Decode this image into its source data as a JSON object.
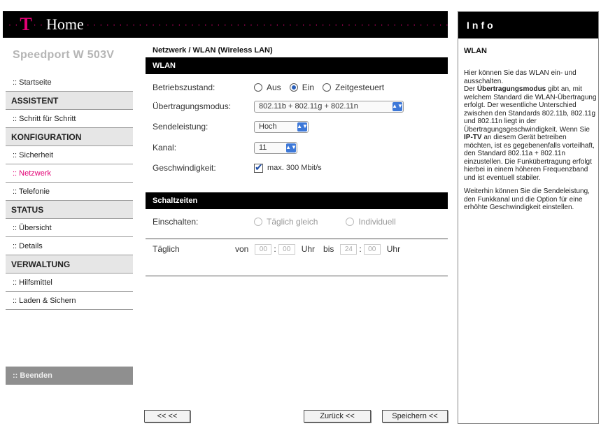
{
  "header": {
    "dots_left": "· ·",
    "logo": "T",
    "dots_mid": "· ·",
    "title": "Home",
    "dots_right": "· · · · · · · · · · · · · · · · · · · · · · · · · · · · · · · · · · · · · · · · · · · · · · · · · · · · · · · · · · · · · · · · · · · · · · · · · · · · · · · · · · · · · · · ·"
  },
  "sidebar": {
    "device_name": "Speedport W 503V",
    "items": [
      {
        "label": ":: Startseite",
        "type": "item"
      },
      {
        "label": "ASSISTENT",
        "type": "section"
      },
      {
        "label": ":: Schritt für Schritt",
        "type": "item"
      },
      {
        "label": "KONFIGURATION",
        "type": "section"
      },
      {
        "label": ":: Sicherheit",
        "type": "item"
      },
      {
        "label": ":: Netzwerk",
        "type": "item",
        "active": true
      },
      {
        "label": ":: Telefonie",
        "type": "item"
      },
      {
        "label": "STATUS",
        "type": "section"
      },
      {
        "label": ":: Übersicht",
        "type": "item"
      },
      {
        "label": ":: Details",
        "type": "item"
      },
      {
        "label": "VERWALTUNG",
        "type": "section"
      },
      {
        "label": ":: Hilfsmittel",
        "type": "item"
      },
      {
        "label": ":: Laden & Sichern",
        "type": "item"
      }
    ],
    "logout_label": ":: Beenden"
  },
  "main": {
    "breadcrumb": "Netzwerk / WLAN (Wireless LAN)",
    "wlan_bar": "WLAN",
    "betriebszustand": {
      "label": "Betriebszustand:",
      "options": [
        "Aus",
        "Ein",
        "Zeitgesteuert"
      ],
      "selected": "Ein"
    },
    "uebertragungsmodus": {
      "label": "Übertragungsmodus:",
      "value": "802.11b + 802.11g + 802.11n"
    },
    "sendeleistung": {
      "label": "Sendeleistung:",
      "value": "Hoch"
    },
    "kanal": {
      "label": "Kanal:",
      "value": "11"
    },
    "geschwindigkeit": {
      "label": "Geschwindigkeit:",
      "checkbox_label": "max. 300 Mbit/s",
      "checked": true
    },
    "schaltzeiten_bar": "Schaltzeiten",
    "einschalten": {
      "label": "Einschalten:",
      "options": [
        "Täglich gleich",
        "Individuell"
      ]
    },
    "taeglich": {
      "label": "Täglich",
      "von": "von",
      "from_h": "00",
      "from_m": "00",
      "uhr1": "Uhr",
      "bis": "bis",
      "to_h": "24",
      "to_m": "00",
      "uhr2": "Uhr"
    }
  },
  "buttons": {
    "back_back": "<< <<",
    "zurueck": "Zurück <<",
    "speichern": "Speichern <<"
  },
  "info": {
    "head": "Info",
    "title": "WLAN",
    "p1_a": "Hier können Sie das WLAN ein- und ausschalten.",
    "p1_b1": "Der ",
    "p1_b_bold": "Übertragungsmodus",
    "p1_b2": " gibt an, mit welchem Standard die WLAN-Übertragung erfolgt. Der wesentliche Unterschied zwischen den Standards 802.11b, 802.11g und 802.11n liegt in der Übertragungsgeschwindigkeit. Wenn Sie ",
    "p1_b_bold2": "IP-TV",
    "p1_b3": " an diesem Gerät betreiben möchten, ist es gegebenenfalls vorteilhaft, den Standard 802.11a + 802.11n einzustellen. Die Funkübertragung erfolgt hierbei in einem höheren Frequenzband und ist eventuell stabiler.",
    "p2": "Weiterhin können Sie die Sendeleistung, den Funkkanal und die Option für eine erhöhte Geschwindigkeit einstellen."
  }
}
